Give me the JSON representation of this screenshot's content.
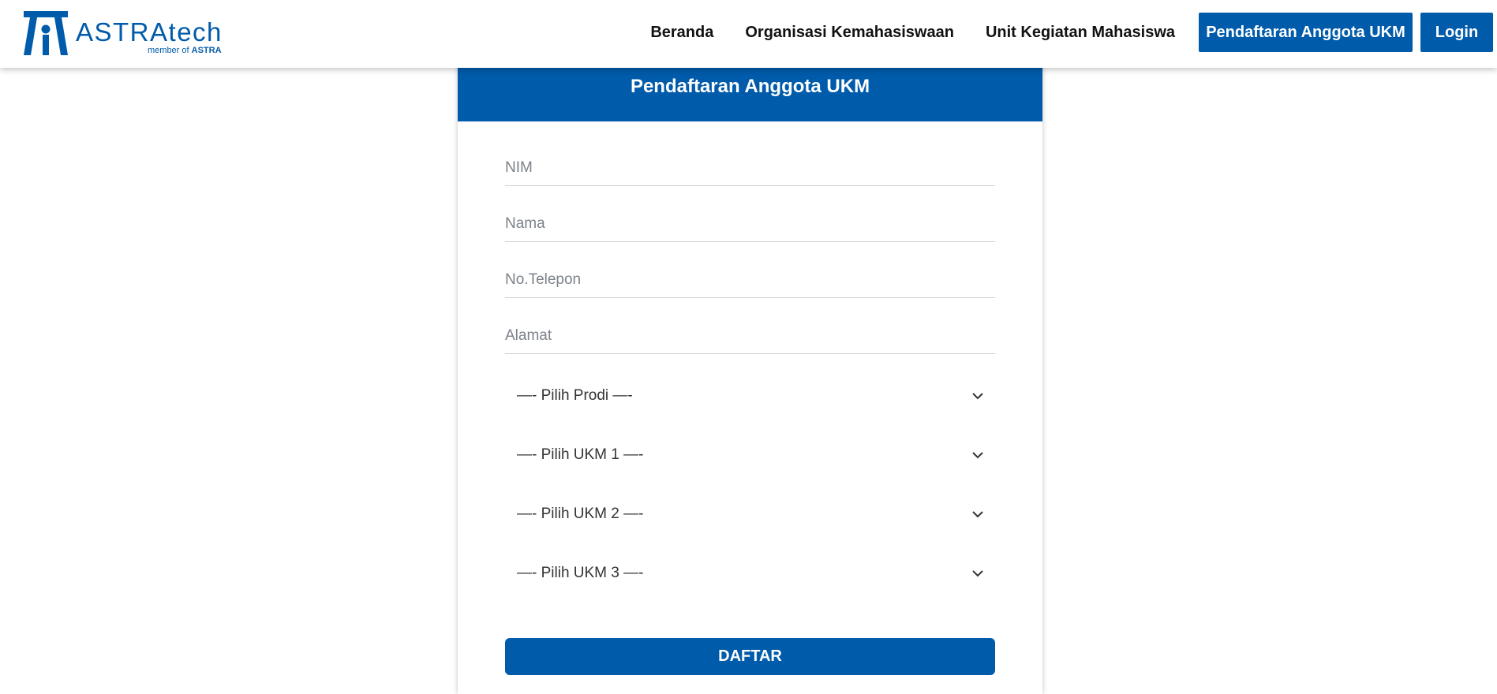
{
  "brand": {
    "name": "ASTRAtech",
    "tagline_prefix": "member of",
    "tagline_brand": "ASTRA",
    "color": "#005baa"
  },
  "nav": {
    "links": [
      "Beranda",
      "Organisasi Kemahasiswaan",
      "Unit Kegiatan Mahasiswa"
    ],
    "register_label": "Pendaftaran Anggota UKM",
    "login_label": "Login"
  },
  "form": {
    "title": "Pendaftaran Anggota UKM",
    "fields": {
      "nim_placeholder": "NIM",
      "nama_placeholder": "Nama",
      "telepon_placeholder": "No.Telepon",
      "alamat_placeholder": "Alamat"
    },
    "selects": {
      "prodi": "—- Pilih Prodi —-",
      "ukm1": "—- Pilih UKM 1 —-",
      "ukm2": "—- Pilih UKM 2 —-",
      "ukm3": "—- Pilih UKM 3 —-"
    },
    "submit_label": "DAFTAR",
    "select_icon": "chevron-down-icon"
  }
}
